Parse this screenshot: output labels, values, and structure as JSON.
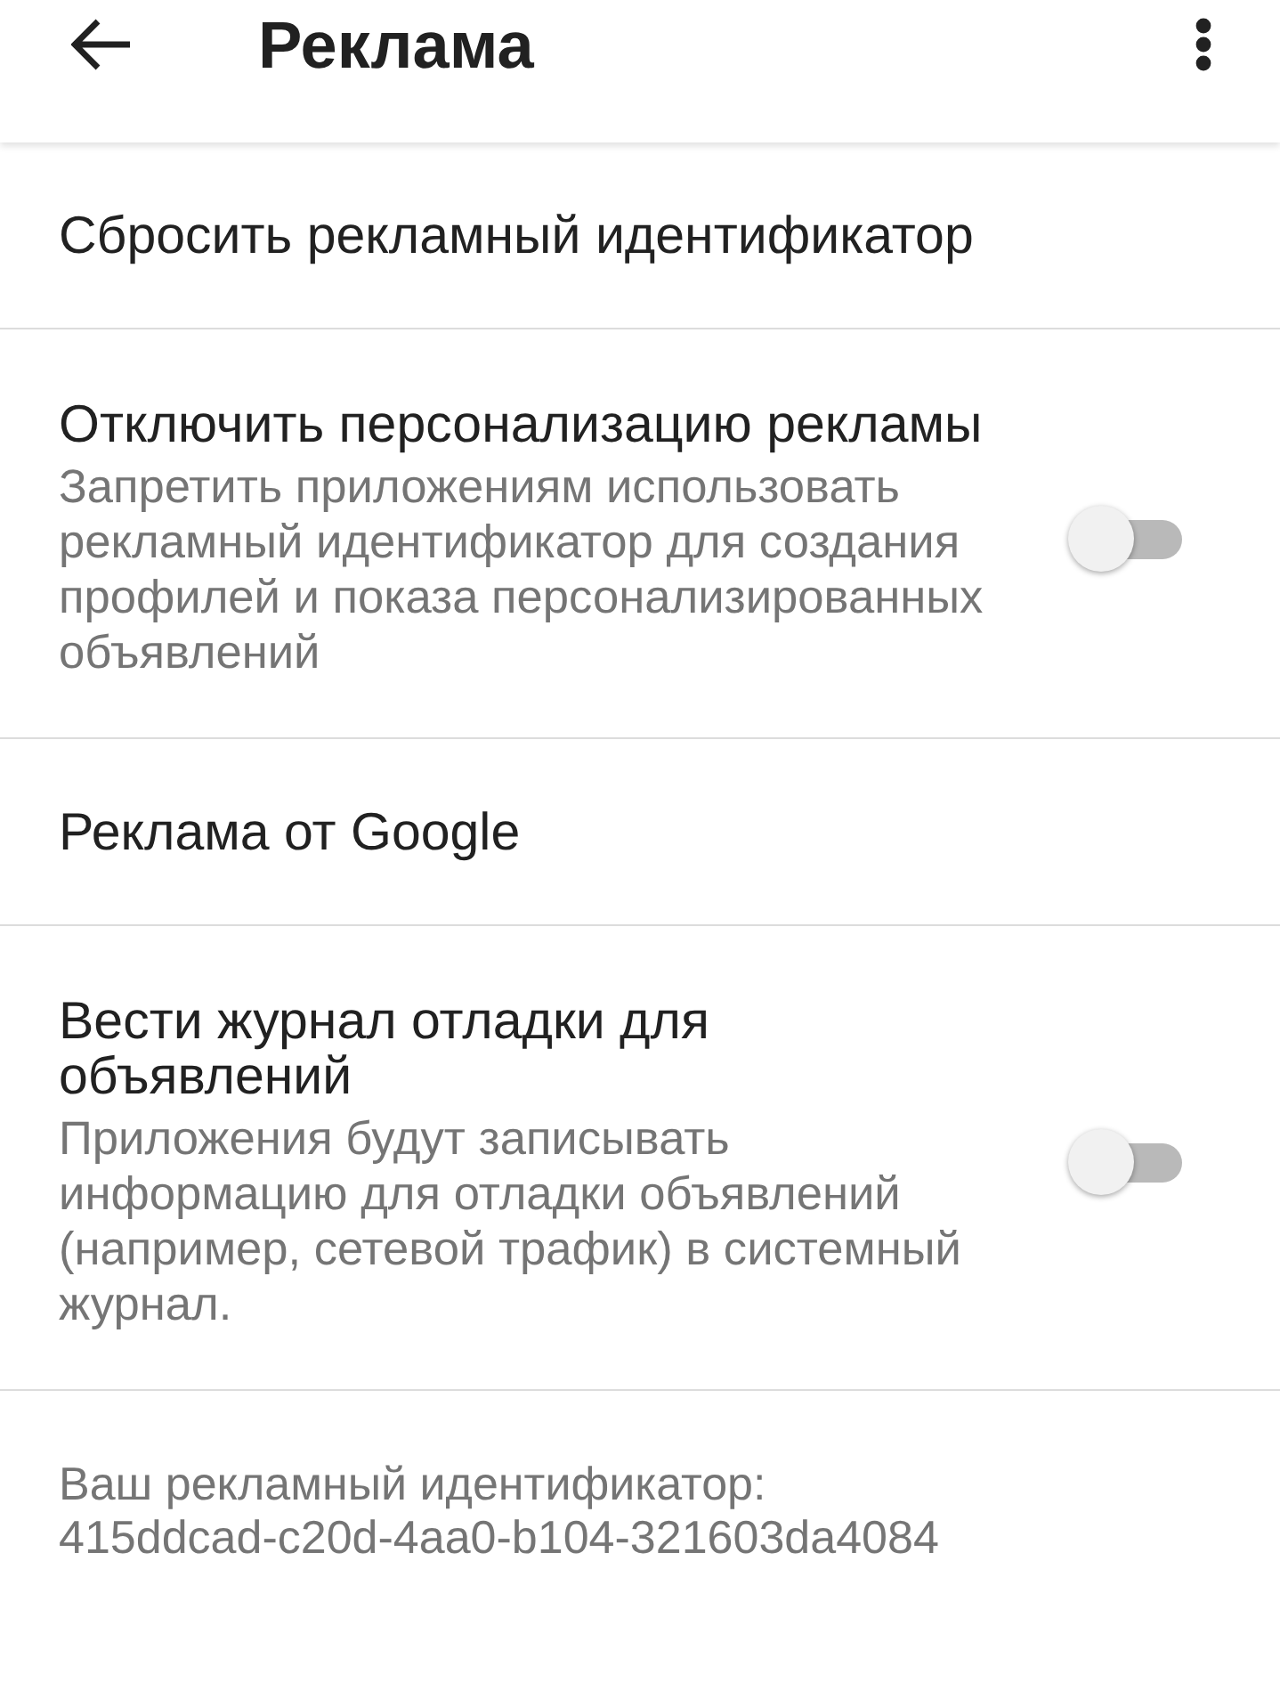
{
  "app_bar": {
    "title": "Реклама"
  },
  "items": [
    {
      "kind": "action",
      "title": "Сбросить рекламный идентификатор"
    },
    {
      "kind": "switch",
      "title": "Отключить персонализацию рекламы",
      "summary": "Запретить приложениям использовать рекламный идентификатор для создания профилей и показа персонализированных объявлений",
      "checked": false
    },
    {
      "kind": "action",
      "title": "Реклама от Google"
    },
    {
      "kind": "switch",
      "title": "Вести журнал отладки для объявлений",
      "summary": "Приложения будут записывать информацию для отладки объявлений (например, сетевой трафик) в системный журнал.",
      "checked": false
    }
  ],
  "footer": {
    "label": "Ваш рекламный идентификатор:",
    "value": "415ddcad-c20d-4aa0-b104-321603da4084"
  }
}
